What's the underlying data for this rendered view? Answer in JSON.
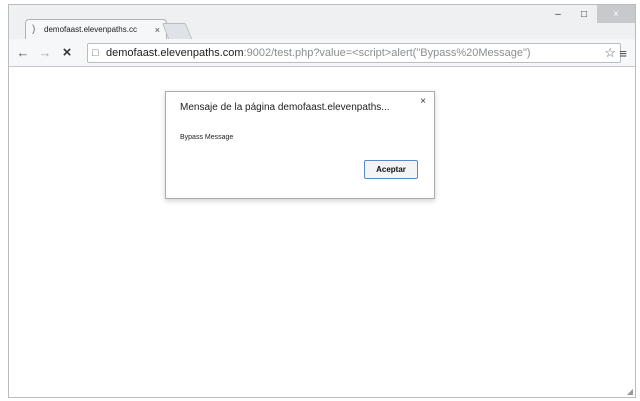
{
  "tab": {
    "title": "demofaast.elevenpaths.cc",
    "favicon": "page-favicon-icon",
    "close": "×"
  },
  "window_controls": {
    "minimize": "–",
    "maximize": "□",
    "close": "×"
  },
  "toolbar": {
    "back": "←",
    "forward": "→",
    "stop": "×",
    "menu": "≡",
    "star": "☆"
  },
  "address": {
    "host": "demofaast.elevenpaths.com",
    "rest": ":9002/test.php?value=<script>alert(\"Bypass%20Message\")",
    "page_icon": "□"
  },
  "dialog": {
    "title": "Mensaje de la página demofaast.elevenpaths...",
    "close": "×",
    "message": "Bypass Message",
    "ok_label": "Aceptar"
  },
  "status": {
    "resize_grip": "◢"
  },
  "colors": {
    "accent": "#5b87c9",
    "chrome": "#eef0f2"
  }
}
